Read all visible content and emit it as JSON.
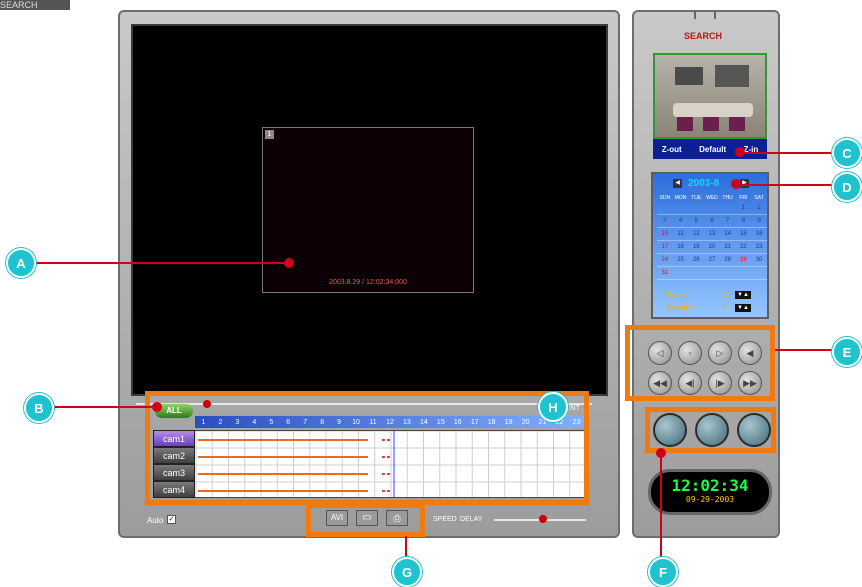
{
  "corner_label": "SEARCH",
  "main_viewer": {
    "channel_number": "1",
    "timestamp": "2003.8.29 / 12:02:34:000"
  },
  "side_panel": {
    "title": "SEARCH",
    "zoom": {
      "zout": "Z-out",
      "default": "Default",
      "zin": "Z-in"
    }
  },
  "calendar": {
    "month_title": "2003-8",
    "weekdays": [
      "SUN",
      "MON",
      "TUE",
      "WED",
      "THU",
      "FRI",
      "SAT"
    ],
    "days": [
      "",
      "",
      "",
      "",
      "",
      "1",
      "2",
      "3",
      "4",
      "5",
      "6",
      "7",
      "8",
      "9",
      "10",
      "11",
      "12",
      "13",
      "14",
      "15",
      "16",
      "17",
      "18",
      "19",
      "20",
      "21",
      "22",
      "23",
      "24",
      "25",
      "26",
      "27",
      "28",
      "29",
      "30",
      "31",
      "",
      "",
      "",
      "",
      "",
      ""
    ],
    "selected_day": "29",
    "hour_label": "Hour :",
    "hour_value": "12",
    "minute_label": "Minute :",
    "minute_value": "2"
  },
  "timeline": {
    "all_label": "ALL",
    "hours": [
      "1",
      "2",
      "3",
      "4",
      "5",
      "6",
      "7",
      "8",
      "9",
      "10",
      "11",
      "12",
      "13",
      "14",
      "15",
      "16",
      "17",
      "18",
      "19",
      "20",
      "21",
      "22",
      "23"
    ],
    "cams": [
      "cam1",
      "cam2",
      "cam3",
      "cam4"
    ],
    "event_label": "ENT"
  },
  "bottom": {
    "auto_label": "Auto",
    "avi_label": "AVI",
    "speed_label": "SPEED",
    "delay_label": "DELAY"
  },
  "clock": {
    "time": "12:02:34",
    "date": "09-29-2003"
  },
  "callouts": {
    "A": "A",
    "B": "B",
    "C": "C",
    "D": "D",
    "E": "E",
    "F": "F",
    "G": "G",
    "H": "H"
  },
  "colors": {
    "orange": "#f07a12",
    "callout": "#1fc2cf",
    "pointer": "#d0001a"
  }
}
